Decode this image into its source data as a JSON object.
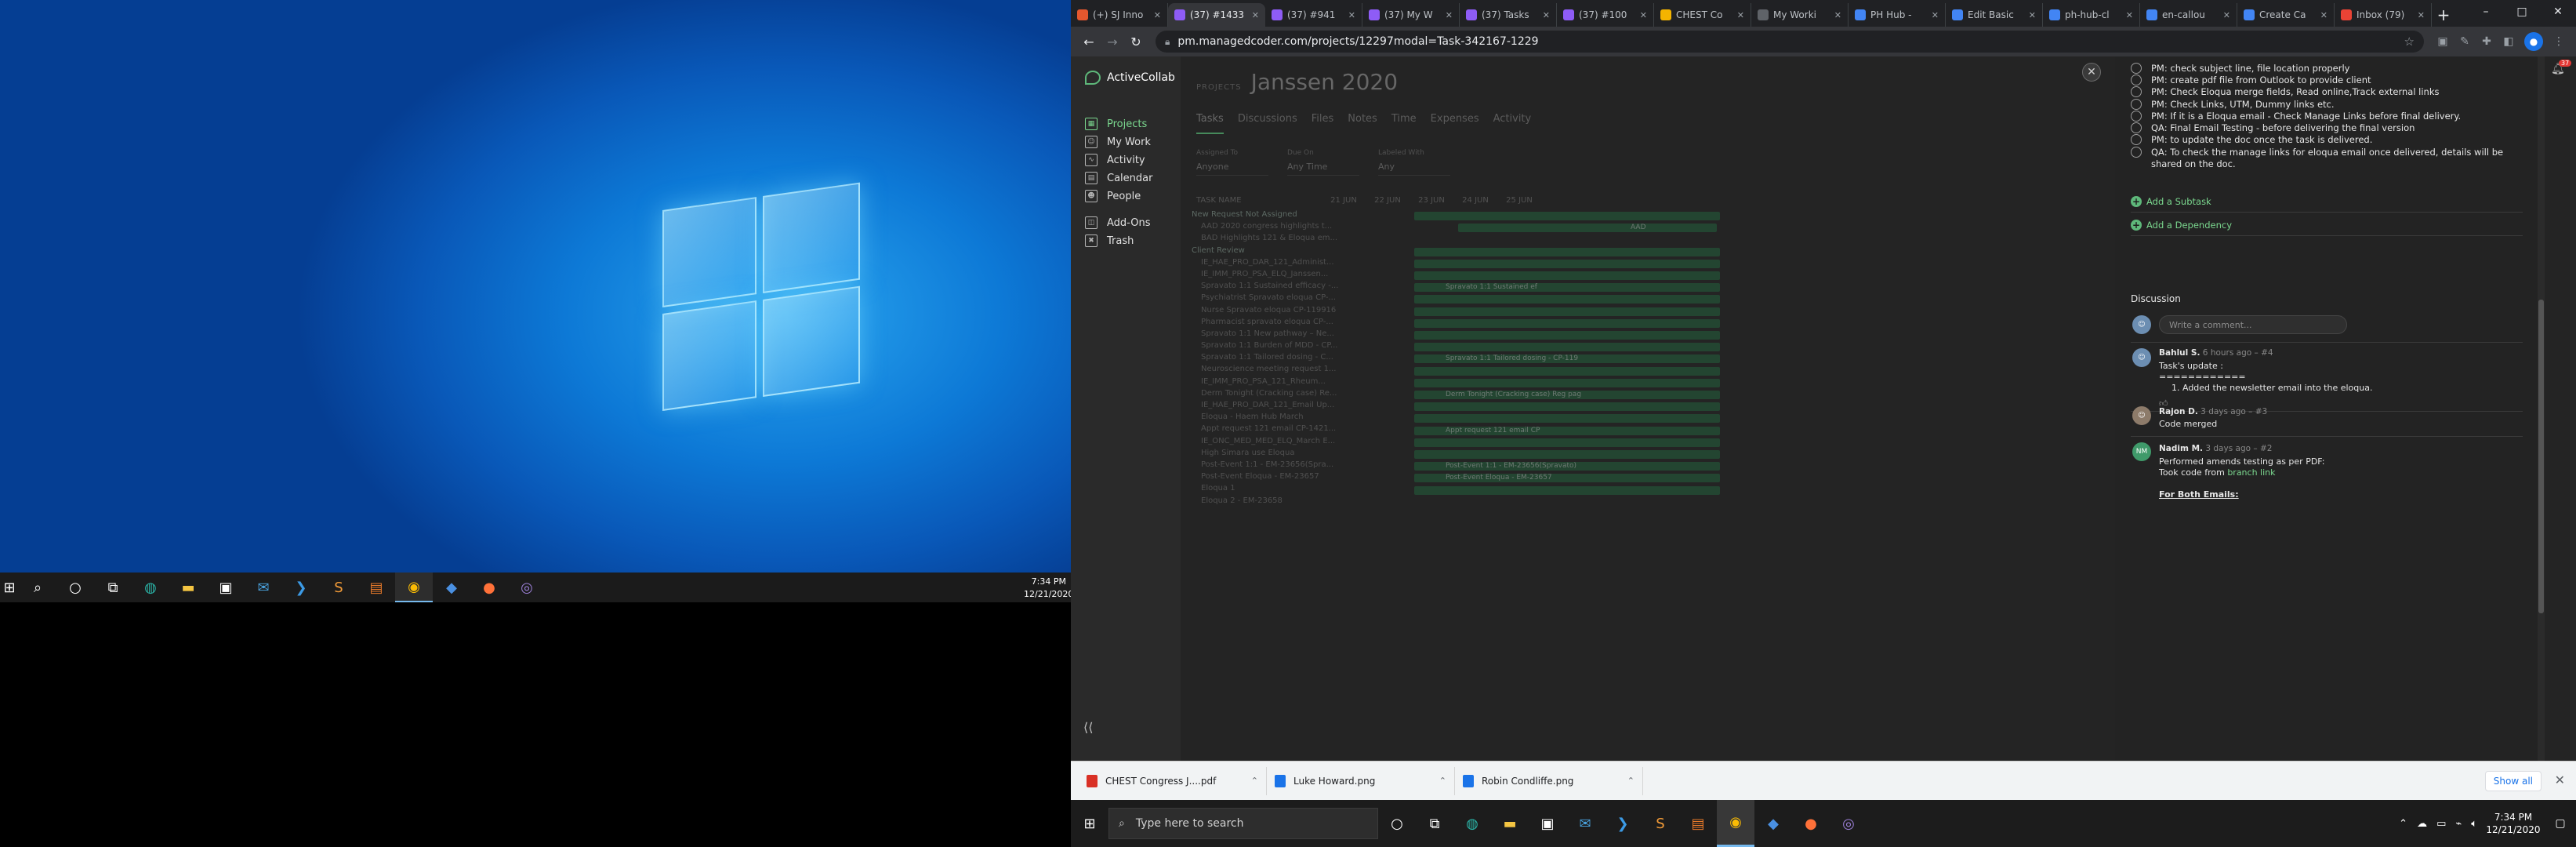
{
  "left_desktop": {
    "taskbar_icons": [
      "windows-icon",
      "search-icon",
      "cortana-icon",
      "task-view-icon",
      "edge-icon",
      "file-explorer-icon",
      "store-icon",
      "mail-icon",
      "vscode-icon",
      "sublime-icon",
      "pgadmin-icon",
      "chrome-icon",
      "app-blue-icon",
      "firefox-icon",
      "app-purple-icon"
    ],
    "clock_time": "7:34 PM",
    "clock_date": "12/21/2020"
  },
  "browser": {
    "tabs": [
      {
        "label": "(+) SJ Inno",
        "color": "#e4572e",
        "active": false
      },
      {
        "label": "(37) #1433",
        "color": "#8e5cf6",
        "active": true
      },
      {
        "label": "(37) #941",
        "color": "#8e5cf6",
        "active": false
      },
      {
        "label": "(37) My W",
        "color": "#8e5cf6",
        "active": false
      },
      {
        "label": "(37) Tasks",
        "color": "#8e5cf6",
        "active": false
      },
      {
        "label": "(37) #100",
        "color": "#8e5cf6",
        "active": false
      },
      {
        "label": "CHEST Co",
        "color": "#f4b400",
        "active": false
      },
      {
        "label": "My Worki",
        "color": "#5f6368",
        "active": false
      },
      {
        "label": "PH Hub -",
        "color": "#4285f4",
        "active": false
      },
      {
        "label": "Edit Basic",
        "color": "#4285f4",
        "active": false
      },
      {
        "label": "ph-hub-cl",
        "color": "#4285f4",
        "active": false
      },
      {
        "label": "en-callou",
        "color": "#4285f4",
        "active": false
      },
      {
        "label": "Create Ca",
        "color": "#4285f4",
        "active": false
      },
      {
        "label": "Inbox (79)",
        "color": "#ea4335",
        "active": false
      }
    ],
    "url": "pm.managedcoder.com/projects/12297modal=Task-342167-1229",
    "window_controls": [
      "–",
      "□",
      "✕"
    ]
  },
  "activecollab": {
    "app_name": "ActiveCollab",
    "nav": [
      {
        "label": "Projects",
        "icon": "projects-icon",
        "active": true
      },
      {
        "label": "My Work",
        "icon": "my-work-icon",
        "active": false
      },
      {
        "label": "Activity",
        "icon": "activity-icon",
        "active": false
      },
      {
        "label": "Calendar",
        "icon": "calendar-icon",
        "active": false
      },
      {
        "label": "People",
        "icon": "people-icon",
        "active": false
      },
      {
        "label": "Add-Ons",
        "icon": "add-ons-icon",
        "active": false
      },
      {
        "label": "Trash",
        "icon": "trash-icon",
        "active": false
      }
    ],
    "project_label": "PROJECTS",
    "project_title": "Janssen 2020",
    "project_tabs": [
      "Tasks",
      "Discussions",
      "Files",
      "Notes",
      "Time",
      "Expenses",
      "Activity"
    ],
    "filters": [
      {
        "label": "Assigned To",
        "value": "Anyone"
      },
      {
        "label": "Due On",
        "value": "Any Time"
      },
      {
        "label": "Labeled With",
        "value": "Any"
      }
    ],
    "gantt_col": "TASK NAME",
    "gantt_days": [
      "21 JUN",
      "22 JUN",
      "23 JUN",
      "24 JUN",
      "25 JUN"
    ],
    "tasks": [
      {
        "name": "New Request Not Assigned",
        "group": true
      },
      {
        "name": "AAD 2020 congress highlights t...",
        "group": false
      },
      {
        "name": "BAD Highlights 121 & Eloqua em...",
        "group": false
      },
      {
        "name": "Client Review",
        "group": true
      },
      {
        "name": "IE_HAE_PRO_DAR_121_Administ...",
        "group": false
      },
      {
        "name": "IE_IMM_PRO_PSA_ELQ_Janssen...",
        "group": false
      },
      {
        "name": "Spravato 1:1 Sustained efficacy -...",
        "group": false
      },
      {
        "name": "Psychiatrist Spravato eloqua CP-...",
        "group": false
      },
      {
        "name": "Nurse Spravato eloqua CP-119916",
        "group": false
      },
      {
        "name": "Pharmacist spravato eloqua CP-...",
        "group": false
      },
      {
        "name": "Spravato 1:1 New pathway – Ne...",
        "group": false
      },
      {
        "name": "Spravato 1:1 Burden of MDD - CP...",
        "group": false
      },
      {
        "name": "Spravato 1:1 Tailored dosing - C...",
        "group": false
      },
      {
        "name": "Neuroscience meeting request 1...",
        "group": false
      },
      {
        "name": "IE_IMM_PRO_PSA_121_Rheum...",
        "group": false
      },
      {
        "name": "Derm Tonight (Cracking case) Re...",
        "group": false
      },
      {
        "name": "IE_HAE_PRO_DAR_121_Email Up...",
        "group": false
      },
      {
        "name": "Eloqua - Haem Hub March",
        "group": false
      },
      {
        "name": "Appt request 121 email CP-1421...",
        "group": false
      },
      {
        "name": "IE_ONC_MED_MED_ELQ_March E...",
        "group": false
      },
      {
        "name": "High Simara use Eloqua",
        "group": false
      },
      {
        "name": "Post-Event 1:1 - EM-23656(Spra...",
        "group": false
      },
      {
        "name": "Post-Event Eloqua - EM-23657",
        "group": false
      },
      {
        "name": "Eloqua 1",
        "group": false
      },
      {
        "name": "Eloqua 2 - EM-23658",
        "group": false
      }
    ],
    "gantt_labels": [
      "AAD",
      "Spravato 1:1 Sustained ef",
      "Spravato 1:1 Tailored dosing - CP-119",
      "Derm Tonight (Cracking case) Reg pag",
      "Appt request 121 email CP",
      "Post-Event 1:1 - EM-23656(Spravato)",
      "Post-Event Eloqua - EM-23657"
    ],
    "modal": {
      "subtasks": [
        "PM: check subject line, file location properly",
        "PM: create pdf file from Outlook to provide client",
        "PM: Check Eloqua merge fields, Read online,Track external links",
        "PM: Check Links, UTM, Dummy links etc.",
        "PM: If it is a Eloqua email - Check Manage Links before final delivery.",
        "QA: Final Email Testing - before delivering the final version",
        "PM: to update the doc once the task is delivered.",
        "QA: To check the manage links for eloqua email once delivered, details will be shared on the doc."
      ],
      "add_subtask": "Add a Subtask",
      "add_dependency": "Add a Dependency",
      "discussion_title": "Discussion",
      "comment_placeholder": "Write a comment...",
      "comments": [
        {
          "author": "Bahlul S.",
          "meta": "6 hours ago – #4",
          "initials": "BS",
          "color": "#6c8eb2",
          "lines": [
            "Task's update :",
            "============",
            "1.  Added the newsletter email into the eloqua."
          ]
        },
        {
          "author": "Rajon D.",
          "meta": "3 days ago – #3",
          "initials": "RD",
          "color": "#8d7b6a",
          "lines": [
            "Code merged"
          ]
        },
        {
          "author": "Nadim M.",
          "meta": "3 days ago – #2",
          "initials": "NM",
          "color": "#3f9a6a",
          "lines": [
            "Performed amends testing as per PDF:",
            "Took code from",
            "For Both Emails:"
          ],
          "link_text": "branch link"
        }
      ],
      "notification_badge": "37"
    }
  },
  "downloads": {
    "items": [
      {
        "name": "CHEST Congress J....pdf",
        "color": "#d93025"
      },
      {
        "name": "Luke Howard.png",
        "color": "#1a73e8"
      },
      {
        "name": "Robin Condliffe.png",
        "color": "#1a73e8"
      }
    ],
    "show_all": "Show all"
  },
  "right_taskbar": {
    "search_placeholder": "Type here to search",
    "clock_time": "7:34 PM",
    "clock_date": "12/21/2020"
  }
}
